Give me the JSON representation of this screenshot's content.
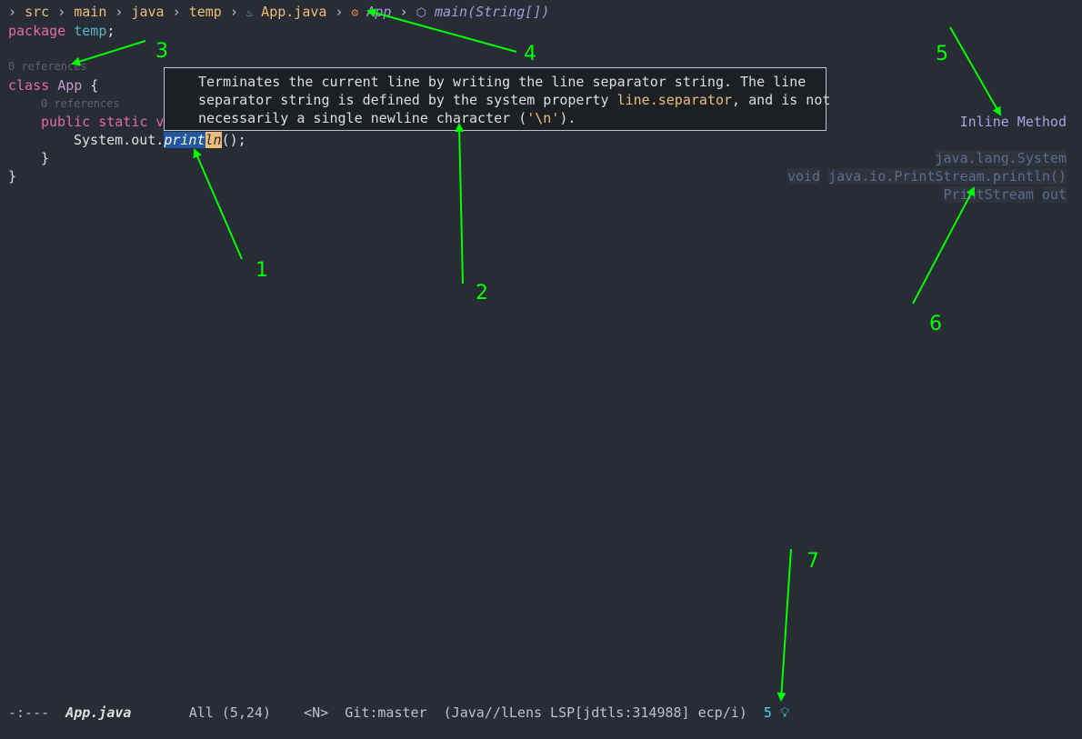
{
  "breadcrumb": {
    "items": [
      "src",
      "main",
      "java",
      "temp"
    ],
    "file": "App.java",
    "class_symbol": "App",
    "method_symbol": "main(String[])",
    "separator": "›"
  },
  "code": {
    "line1_kw": "package",
    "line1_name": "temp",
    "line1_end": ";",
    "codelens_class": "0 references",
    "line2_kw": "class",
    "line2_name": "App",
    "line2_brace": " {",
    "codelens_method": "0 references",
    "line3_mods": "public static v",
    "line4_prefix": "System.out.",
    "line4_hl": "print",
    "line4_hl2": "ln",
    "line4_suffix": "();",
    "line5": "}",
    "line6": "}"
  },
  "doc_popup": {
    "line1": "Terminates the current line by writing the line separator string. The line",
    "line2_pre": "separator string is defined by the system property ",
    "line2_code": "line.separator",
    "line2_post": ", and is not",
    "line3_pre": "necessarily a single newline character (",
    "line3_code": "'\\n'",
    "line3_post": ")."
  },
  "sideline": {
    "code_action": "Inline Method",
    "sym1": "java.lang.System",
    "sym2_a": "void",
    "sym2_b": "java.io.PrintStream.println()",
    "sym3_a": "PrintStream",
    "sym3_b": "out"
  },
  "modeline": {
    "state": "-:---",
    "filename": "App.java",
    "position": "All (5,24)",
    "evil_state": "<N>",
    "vcs": "Git:master",
    "modes": "(Java//lLens LSP[jdtls:314988] ecp/i)",
    "diag_count": "5"
  },
  "annotations": [
    "1",
    "2",
    "3",
    "4",
    "5",
    "6",
    "7"
  ],
  "colors": {
    "background": "#282c34",
    "annotation": "#00ff00",
    "selection": "#2257a0",
    "string": "#ecbe7b"
  },
  "icons": {
    "separator": "chevron-right-icon",
    "file": "java-file-icon",
    "class": "class-icon",
    "method": "method-cube-icon",
    "lightbulb": "lightbulb-icon"
  }
}
